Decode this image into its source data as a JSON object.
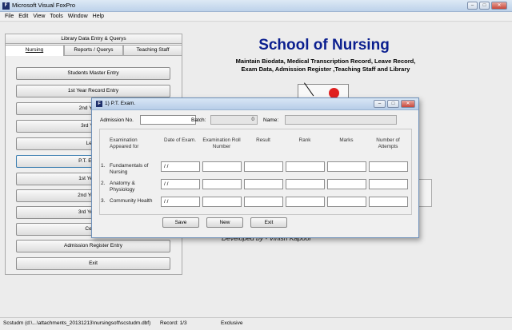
{
  "window": {
    "title": "Microsoft Visual FoxPro",
    "icon": "foxpro-icon"
  },
  "menu": [
    "File",
    "Edit",
    "View",
    "Tools",
    "Window",
    "Help"
  ],
  "left_panel": {
    "header": "Library Data Entry & Querys",
    "tabs": [
      "Nursing",
      "Reports / Querys",
      "Teaching Staff"
    ],
    "buttons": [
      "Students Master Entry",
      "1st Year Record Entry",
      "2nd Year Re",
      "3rd Year R",
      "Leave",
      "P.T. Exam. E",
      "1st Year Exa",
      "2nd Year Exa",
      "3rd Year Exa",
      "Certific",
      "Admission Register Entry",
      "Exit"
    ]
  },
  "school": {
    "title": "School of Nursing",
    "sub1": "Maintain Biodata, Medical Transcription Record, Leave Record,",
    "sub2": "Exam Data, Admission Register ,Teaching Staff and Library",
    "developed": "Developed by - Vinish Kapoor"
  },
  "dialog": {
    "title": "1) P.T. Exam.",
    "admission_label": "Admission No.",
    "admission_value": "",
    "batch_label": "Batch:",
    "batch_value": "0",
    "name_label": "Name:",
    "name_value": "",
    "columns": [
      "Examination Appeared for",
      "Date of Exam.",
      "Examination Roll Number",
      "Result",
      "Rank",
      "Marks",
      "Number of Attempts"
    ],
    "rows": [
      {
        "num": "1.",
        "subject": "Fundamentals of Nursing",
        "date": "/ /"
      },
      {
        "num": "2.",
        "subject": "Anatomy & Physiology",
        "date": "/ /"
      },
      {
        "num": "3.",
        "subject": "Community Health",
        "date": "/ /"
      }
    ],
    "buttons": {
      "save": "Save",
      "new": "New",
      "exit": "Exit"
    }
  },
  "status": {
    "path": "Scstudm (d:\\...\\attachments_20131213\\nursingsoft\\scstudm.dbf)",
    "record": "Record: 1/3",
    "mode": "Exclusive"
  }
}
